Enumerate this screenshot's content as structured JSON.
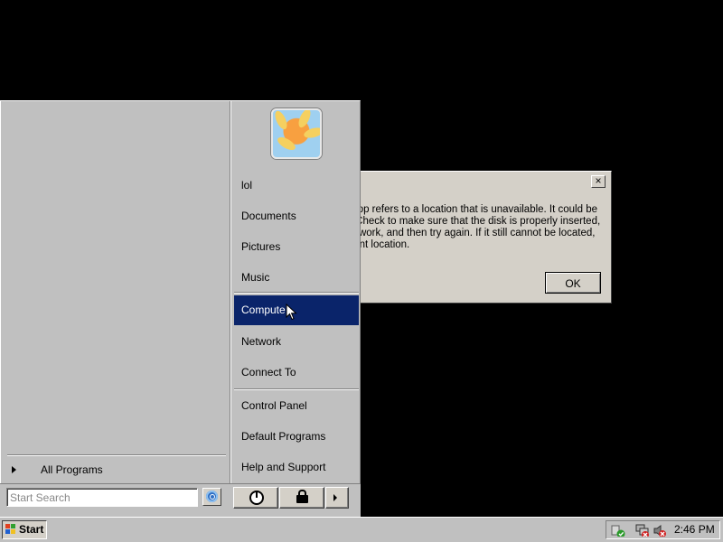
{
  "dialog": {
    "close_label": "×",
    "message_lines": [
      "sktop refers to a location that is unavailable. It could be",
      "k. Check to make sure that the disk is properly inserted,",
      "network, and then try again. If it still cannot be located,",
      "erent location."
    ],
    "ok_label": "OK"
  },
  "start_menu": {
    "user_picture": "goldfish-avatar",
    "right_items": [
      {
        "label": "lol"
      },
      {
        "label": "Documents"
      },
      {
        "label": "Pictures"
      },
      {
        "label": "Music"
      },
      {
        "label": "Computer",
        "selected": true
      },
      {
        "label": "Network"
      },
      {
        "label": "Connect To"
      },
      {
        "label": "Control Panel"
      },
      {
        "label": "Default Programs"
      },
      {
        "label": "Help and Support"
      }
    ],
    "all_programs_label": "All Programs",
    "search": {
      "placeholder": "Start Search",
      "value": ""
    },
    "buttons": {
      "power_icon": "power-icon",
      "lock_icon": "lock-icon",
      "more_icon": "arrow-right-icon"
    }
  },
  "taskbar": {
    "start_label": "Start",
    "tray_icons": [
      "security-shield-icon",
      "network-disconnected-icon",
      "volume-muted-icon"
    ],
    "clock": "2:46 PM"
  },
  "colors": {
    "desktop": "#000000",
    "selection": "#0a246a",
    "face": "#c0c0c0"
  }
}
